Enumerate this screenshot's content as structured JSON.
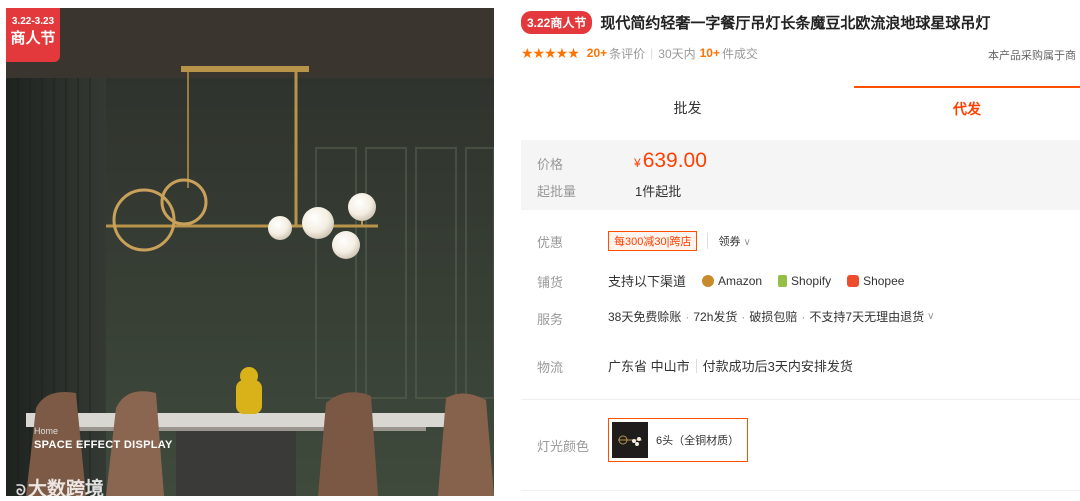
{
  "hero": {
    "badge_dates": "3.22-3.23",
    "badge_name": "商人节",
    "caption_small": "Home",
    "caption_main": "SPACE EFFECT DISPLAY",
    "watermark": "大数跨境"
  },
  "product": {
    "promo_tag": "3.22商人节",
    "title": "现代简约轻奢一字餐厅吊灯长条魔豆北欧流浪地球星球吊灯"
  },
  "rating": {
    "stars": "★★★★★",
    "review_count": "20+",
    "review_label": "条评价",
    "period_label": "30天内",
    "deal_count": "10+",
    "deal_label": "件成交",
    "note_right": "本产品采购属于商"
  },
  "tabs": {
    "wholesale": "批发",
    "dropship": "代发"
  },
  "price_box": {
    "price_label": "价格",
    "currency": "¥",
    "price": "639.00",
    "moq_label": "起批量",
    "moq": "1件起批"
  },
  "promo": {
    "label": "优惠",
    "coupon": "每300减30|跨店",
    "get_coupon": "领券",
    "chevron": "∨"
  },
  "distribution": {
    "label": "铺货",
    "intro": "支持以下渠道",
    "channels": [
      "Amazon",
      "Shopify",
      "Shopee"
    ]
  },
  "service": {
    "label": "服务",
    "items": [
      "38天免费赊账",
      "72h发货",
      "破损包赔",
      "不支持7天无理由退货"
    ],
    "chevron": "∨"
  },
  "logistics": {
    "label": "物流",
    "location": "广东省 中山市",
    "shipping": "付款成功后3天内安排发货"
  },
  "light_color": {
    "label": "灯光颜色",
    "option": "6头（全铜材质）"
  }
}
